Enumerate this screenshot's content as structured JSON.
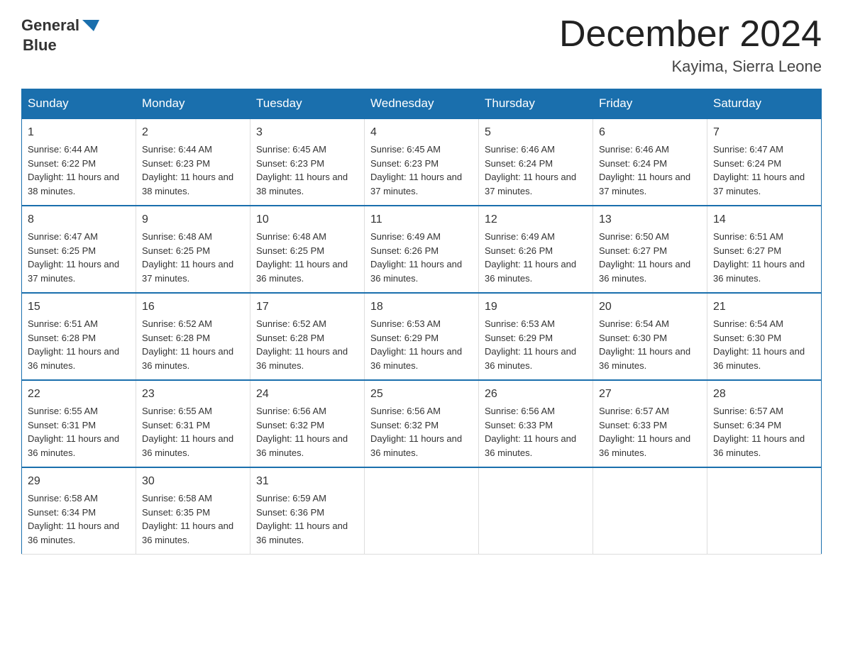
{
  "header": {
    "logo_line1": "General",
    "logo_line2": "Blue",
    "month_title": "December 2024",
    "location": "Kayima, Sierra Leone"
  },
  "weekdays": [
    "Sunday",
    "Monday",
    "Tuesday",
    "Wednesday",
    "Thursday",
    "Friday",
    "Saturday"
  ],
  "weeks": [
    [
      {
        "day": "1",
        "sunrise": "6:44 AM",
        "sunset": "6:22 PM",
        "daylight": "11 hours and 38 minutes."
      },
      {
        "day": "2",
        "sunrise": "6:44 AM",
        "sunset": "6:23 PM",
        "daylight": "11 hours and 38 minutes."
      },
      {
        "day": "3",
        "sunrise": "6:45 AM",
        "sunset": "6:23 PM",
        "daylight": "11 hours and 38 minutes."
      },
      {
        "day": "4",
        "sunrise": "6:45 AM",
        "sunset": "6:23 PM",
        "daylight": "11 hours and 37 minutes."
      },
      {
        "day": "5",
        "sunrise": "6:46 AM",
        "sunset": "6:24 PM",
        "daylight": "11 hours and 37 minutes."
      },
      {
        "day": "6",
        "sunrise": "6:46 AM",
        "sunset": "6:24 PM",
        "daylight": "11 hours and 37 minutes."
      },
      {
        "day": "7",
        "sunrise": "6:47 AM",
        "sunset": "6:24 PM",
        "daylight": "11 hours and 37 minutes."
      }
    ],
    [
      {
        "day": "8",
        "sunrise": "6:47 AM",
        "sunset": "6:25 PM",
        "daylight": "11 hours and 37 minutes."
      },
      {
        "day": "9",
        "sunrise": "6:48 AM",
        "sunset": "6:25 PM",
        "daylight": "11 hours and 37 minutes."
      },
      {
        "day": "10",
        "sunrise": "6:48 AM",
        "sunset": "6:25 PM",
        "daylight": "11 hours and 36 minutes."
      },
      {
        "day": "11",
        "sunrise": "6:49 AM",
        "sunset": "6:26 PM",
        "daylight": "11 hours and 36 minutes."
      },
      {
        "day": "12",
        "sunrise": "6:49 AM",
        "sunset": "6:26 PM",
        "daylight": "11 hours and 36 minutes."
      },
      {
        "day": "13",
        "sunrise": "6:50 AM",
        "sunset": "6:27 PM",
        "daylight": "11 hours and 36 minutes."
      },
      {
        "day": "14",
        "sunrise": "6:51 AM",
        "sunset": "6:27 PM",
        "daylight": "11 hours and 36 minutes."
      }
    ],
    [
      {
        "day": "15",
        "sunrise": "6:51 AM",
        "sunset": "6:28 PM",
        "daylight": "11 hours and 36 minutes."
      },
      {
        "day": "16",
        "sunrise": "6:52 AM",
        "sunset": "6:28 PM",
        "daylight": "11 hours and 36 minutes."
      },
      {
        "day": "17",
        "sunrise": "6:52 AM",
        "sunset": "6:28 PM",
        "daylight": "11 hours and 36 minutes."
      },
      {
        "day": "18",
        "sunrise": "6:53 AM",
        "sunset": "6:29 PM",
        "daylight": "11 hours and 36 minutes."
      },
      {
        "day": "19",
        "sunrise": "6:53 AM",
        "sunset": "6:29 PM",
        "daylight": "11 hours and 36 minutes."
      },
      {
        "day": "20",
        "sunrise": "6:54 AM",
        "sunset": "6:30 PM",
        "daylight": "11 hours and 36 minutes."
      },
      {
        "day": "21",
        "sunrise": "6:54 AM",
        "sunset": "6:30 PM",
        "daylight": "11 hours and 36 minutes."
      }
    ],
    [
      {
        "day": "22",
        "sunrise": "6:55 AM",
        "sunset": "6:31 PM",
        "daylight": "11 hours and 36 minutes."
      },
      {
        "day": "23",
        "sunrise": "6:55 AM",
        "sunset": "6:31 PM",
        "daylight": "11 hours and 36 minutes."
      },
      {
        "day": "24",
        "sunrise": "6:56 AM",
        "sunset": "6:32 PM",
        "daylight": "11 hours and 36 minutes."
      },
      {
        "day": "25",
        "sunrise": "6:56 AM",
        "sunset": "6:32 PM",
        "daylight": "11 hours and 36 minutes."
      },
      {
        "day": "26",
        "sunrise": "6:56 AM",
        "sunset": "6:33 PM",
        "daylight": "11 hours and 36 minutes."
      },
      {
        "day": "27",
        "sunrise": "6:57 AM",
        "sunset": "6:33 PM",
        "daylight": "11 hours and 36 minutes."
      },
      {
        "day": "28",
        "sunrise": "6:57 AM",
        "sunset": "6:34 PM",
        "daylight": "11 hours and 36 minutes."
      }
    ],
    [
      {
        "day": "29",
        "sunrise": "6:58 AM",
        "sunset": "6:34 PM",
        "daylight": "11 hours and 36 minutes."
      },
      {
        "day": "30",
        "sunrise": "6:58 AM",
        "sunset": "6:35 PM",
        "daylight": "11 hours and 36 minutes."
      },
      {
        "day": "31",
        "sunrise": "6:59 AM",
        "sunset": "6:36 PM",
        "daylight": "11 hours and 36 minutes."
      },
      null,
      null,
      null,
      null
    ]
  ],
  "labels": {
    "sunrise": "Sunrise: ",
    "sunset": "Sunset: ",
    "daylight": "Daylight: "
  }
}
